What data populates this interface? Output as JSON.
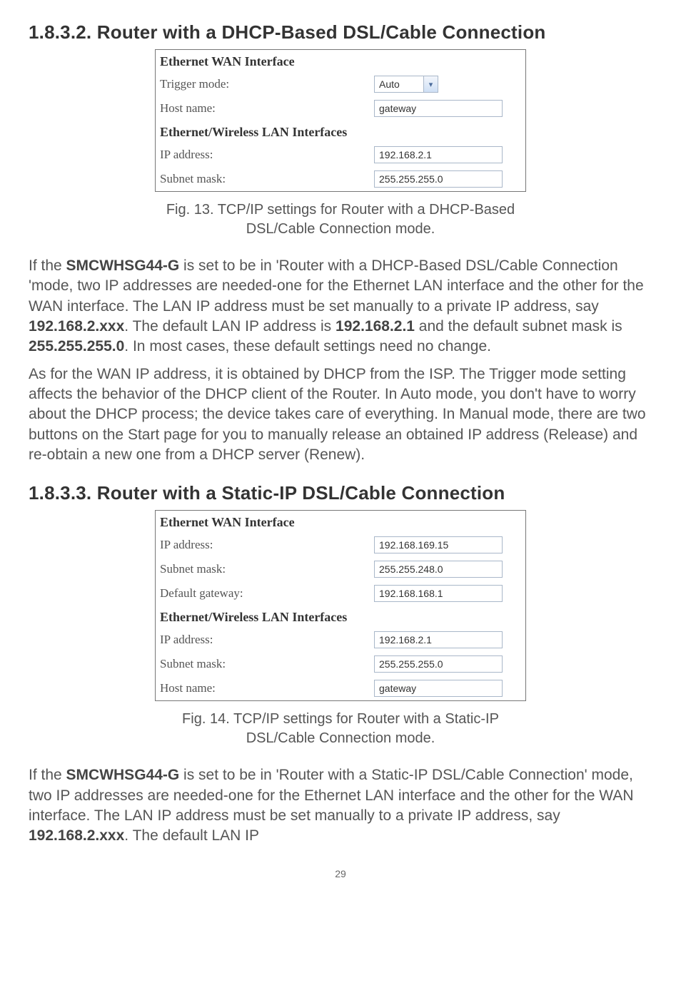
{
  "section1": {
    "heading": "1.8.3.2. Router with a DHCP-Based DSL/Cable Connection",
    "table": {
      "section_a": "Ethernet WAN Interface",
      "rows_a": [
        {
          "label": "Trigger mode:",
          "type": "select",
          "value": "Auto"
        },
        {
          "label": "Host name:",
          "type": "input",
          "value": "gateway"
        }
      ],
      "section_b": "Ethernet/Wireless LAN Interfaces",
      "rows_b": [
        {
          "label": "IP address:",
          "type": "input",
          "value": "192.168.2.1"
        },
        {
          "label": "Subnet mask:",
          "type": "input",
          "value": "255.255.255.0"
        }
      ]
    },
    "caption_l1": "Fig. 13. TCP/IP settings for Router with a DHCP-Based",
    "caption_l2": "DSL/Cable Connection mode.",
    "para1_parts": [
      "If the ",
      "SMCWHSG44-G",
      " is set to be in 'Router with a DHCP-Based DSL/Cable Connection 'mode, two IP addresses are needed-one for the Ethernet LAN interface and the other for the WAN interface. The LAN IP address must be set manually to a private IP address, say ",
      "192.168.2.xxx",
      ". The default LAN IP address is ",
      "192.168.2.1",
      " and the default subnet mask is ",
      "255.255.255.0",
      ". In most cases, these default settings need no change."
    ],
    "para2": "As for the WAN IP address, it is obtained by DHCP from the ISP. The Trigger mode setting affects the behavior of the DHCP client of the Router. In Auto mode, you don't have to worry about the DHCP process; the device takes care of everything. In Manual mode, there are two buttons on the Start page for you to manually release an obtained IP address (Release) and re-obtain a new one from a DHCP server (Renew)."
  },
  "section2": {
    "heading": "1.8.3.3. Router with a Static-IP DSL/Cable Connection",
    "table": {
      "section_a": "Ethernet WAN Interface",
      "rows_a": [
        {
          "label": "IP address:",
          "type": "input",
          "value": "192.168.169.15"
        },
        {
          "label": "Subnet mask:",
          "type": "input",
          "value": "255.255.248.0"
        },
        {
          "label": "Default gateway:",
          "type": "input",
          "value": "192.168.168.1"
        }
      ],
      "section_b": "Ethernet/Wireless LAN Interfaces",
      "rows_b": [
        {
          "label": "IP address:",
          "type": "input",
          "value": "192.168.2.1"
        },
        {
          "label": "Subnet mask:",
          "type": "input",
          "value": "255.255.255.0"
        },
        {
          "label": "Host name:",
          "type": "input",
          "value": "gateway"
        }
      ]
    },
    "caption_l1": "Fig. 14. TCP/IP settings for Router with a Static-IP",
    "caption_l2": "DSL/Cable Connection mode.",
    "para1_parts": [
      "If the ",
      "SMCWHSG44-G",
      " is set to be in 'Router with a Static-IP DSL/Cable Connection' mode, two IP addresses are needed-one for the Ethernet LAN interface and the other for the WAN interface. The LAN IP address must be set manually to a private IP address, say ",
      "192.168.2.xxx",
      ". The default LAN IP"
    ]
  },
  "page_number": "29"
}
